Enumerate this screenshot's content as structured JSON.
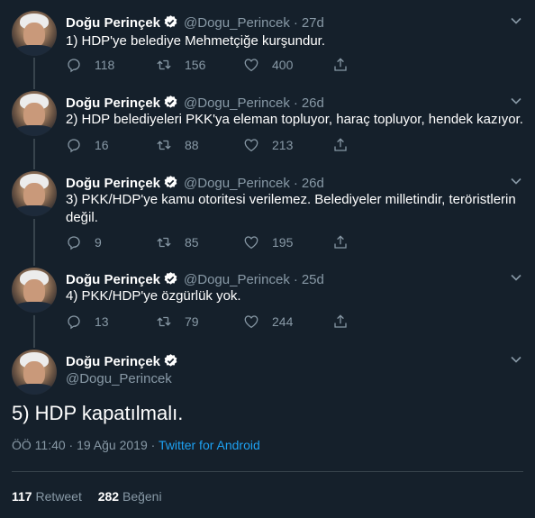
{
  "author": {
    "name": "Doğu Perinçek",
    "handle": "@Dogu_Perincek"
  },
  "thread": [
    {
      "time": "27d",
      "text": "1) HDP'ye belediye Mehmetçiğe kurşundur.",
      "replies": "118",
      "retweets": "156",
      "likes": "400"
    },
    {
      "time": "26d",
      "text": "2) HDP belediyeleri PKK'ya eleman topluyor, haraç topluyor, hendek kazıyor.",
      "replies": "16",
      "retweets": "88",
      "likes": "213"
    },
    {
      "time": "26d",
      "text": "3) PKK/HDP'ye kamu otoritesi verilemez. Belediyeler milletindir, teröristlerin değil.",
      "replies": "9",
      "retweets": "85",
      "likes": "195"
    },
    {
      "time": "25d",
      "text": "4) PKK/HDP'ye özgürlük yok.",
      "replies": "13",
      "retweets": "79",
      "likes": "244"
    }
  ],
  "main_tweet": {
    "text": "5) HDP kapatılmalı.",
    "timestamp": "ÖÖ 11:40 · 19 Ağu 2019 ·",
    "source": "Twitter for Android",
    "retweet_count": "117",
    "retweet_label": "Retweet",
    "like_count": "282",
    "like_label": "Beğeni"
  },
  "icons": {
    "reply": "reply-icon",
    "retweet": "retweet-icon",
    "like": "heart-icon",
    "share": "share-icon",
    "verified": "verified-badge-icon",
    "caret": "chevron-down-icon"
  },
  "colors": {
    "background": "#15202b",
    "muted": "#8899a6",
    "link": "#1da1f2",
    "divider": "#38444d"
  }
}
